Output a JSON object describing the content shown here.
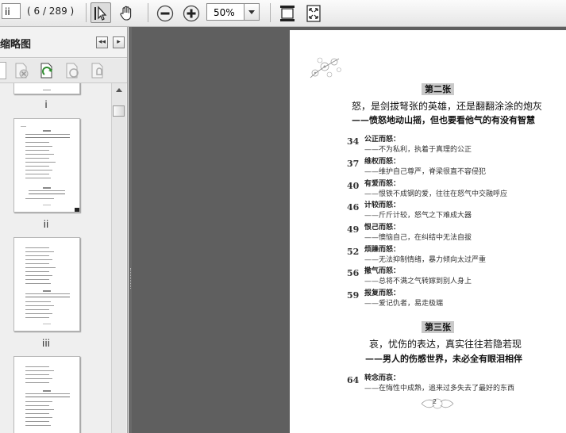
{
  "toolbar": {
    "page_input": "ii",
    "page_count": "( 6 / 289 )",
    "zoom": "50%"
  },
  "panel": {
    "title": "缩略图",
    "collapse_label": "◂◂",
    "next_label": "▸",
    "thumbs": [
      {
        "label": "i"
      },
      {
        "label": "ii"
      },
      {
        "label": "iii"
      },
      {
        "label": ""
      }
    ]
  },
  "page": {
    "sections": [
      {
        "heading": "第二张",
        "line1": "怒，是剑拔弩张的英雄，还是翻翻涂涂的炮灰",
        "line2": "——愤怒地动山摇，但也要看他气的有没有智慧",
        "entries": [
          {
            "num": "34",
            "title": "公正而怒：",
            "sub": "——不为私利，执着于真理的公正"
          },
          {
            "num": "37",
            "title": "维权而怒：",
            "sub": "——维护自己尊严，脊梁很直不容侵犯"
          },
          {
            "num": "40",
            "title": "有爱而怒：",
            "sub": "——恨铁不成钢的爱，往往在怒气中交融呼应"
          },
          {
            "num": "46",
            "title": "计较而怒：",
            "sub": "——斤斤计较，怒气之下难成大器"
          },
          {
            "num": "49",
            "title": "恨己而怒：",
            "sub": "——懊恼自己，在纠结中无法自拔"
          },
          {
            "num": "52",
            "title": "烦躁而怒：",
            "sub": "——无法抑制情绪，暴力倾向太过严重"
          },
          {
            "num": "56",
            "title": "撒气而怒：",
            "sub": "——总将不满之气转嫁到别人身上"
          },
          {
            "num": "59",
            "title": "报复而怒：",
            "sub": "——爱记仇者，易走极端"
          }
        ]
      },
      {
        "heading": "第三张",
        "line1": "哀，忧伤的表达，真实往往若隐若现",
        "line2": "——男人的伤感世界，未必全有眼泪相伴",
        "entries": [
          {
            "num": "64",
            "title": "转念而哀：",
            "sub": "——在悔性中成熟，追来过多失去了最好的东西"
          }
        ]
      }
    ],
    "page_number": "2"
  }
}
